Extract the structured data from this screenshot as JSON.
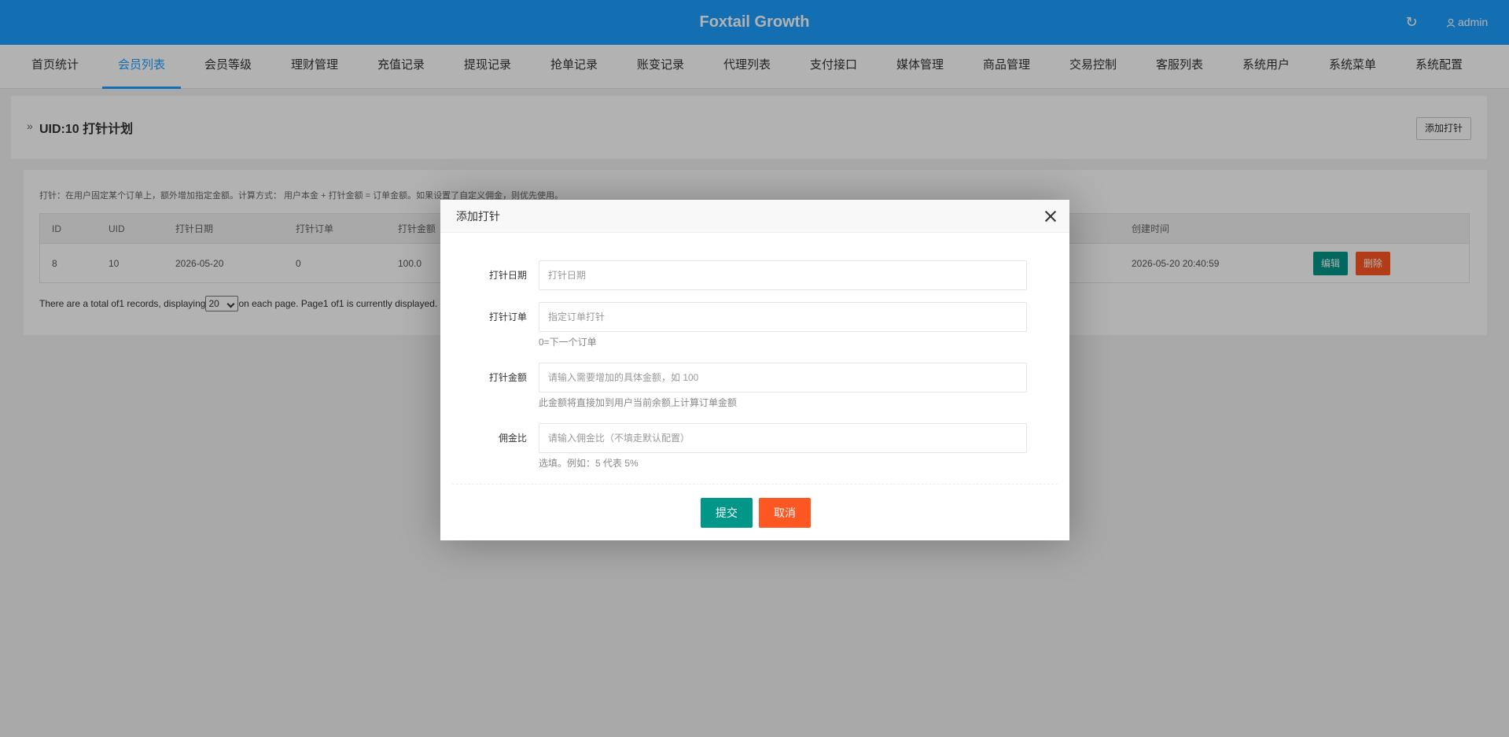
{
  "header": {
    "title": "Foxtail Growth",
    "user": "admin"
  },
  "nav": {
    "tabs": [
      "首页统计",
      "会员列表",
      "会员等级",
      "理财管理",
      "充值记录",
      "提现记录",
      "抢单记录",
      "账变记录",
      "代理列表",
      "支付接口",
      "媒体管理",
      "商品管理",
      "交易控制",
      "客服列表",
      "系统用户",
      "系统菜单",
      "系统配置"
    ],
    "active": "会员列表"
  },
  "page": {
    "title": "UID:10 打针计划",
    "add_button": "添加打针"
  },
  "description": "打针：在用户固定某个订单上，额外增加指定金额。计算方式： 用户本金 + 打针金额 = 订单金额。如果设置了自定义佣金，则优先使用。",
  "table": {
    "headers": [
      "ID",
      "UID",
      "打针日期",
      "打针订单",
      "打针金额",
      "创建时间"
    ],
    "rows": [
      {
        "id": "8",
        "uid": "10",
        "date": "2026-05-20",
        "order": "0",
        "amount": "100.0",
        "created": "2026-05-20 20:40:59"
      }
    ],
    "actions": {
      "edit": "编辑",
      "delete": "删除"
    }
  },
  "pagination": {
    "prefix": "There are a total of1 records, displaying",
    "page_size": "20",
    "suffix": " on each page. Page1 of1 is currently displayed."
  },
  "modal": {
    "title": "添加打针",
    "fields": [
      {
        "label": "打针日期",
        "placeholder": "打针日期",
        "hint": ""
      },
      {
        "label": "打针订单",
        "placeholder": "指定订单打针",
        "hint": "0=下一个订单"
      },
      {
        "label": "打针金额",
        "placeholder": "请输入需要增加的具体金额，如 100",
        "hint": "此金额将直接加到用户当前余额上计算订单金额"
      },
      {
        "label": "佣金比",
        "placeholder": "请输入佣金比（不填走默认配置）",
        "hint": "选填。例如：5 代表 5%"
      }
    ],
    "submit": "提交",
    "cancel": "取消"
  },
  "colors": {
    "primary": "#1e9fff",
    "success": "#009688",
    "danger": "#ff5722"
  }
}
